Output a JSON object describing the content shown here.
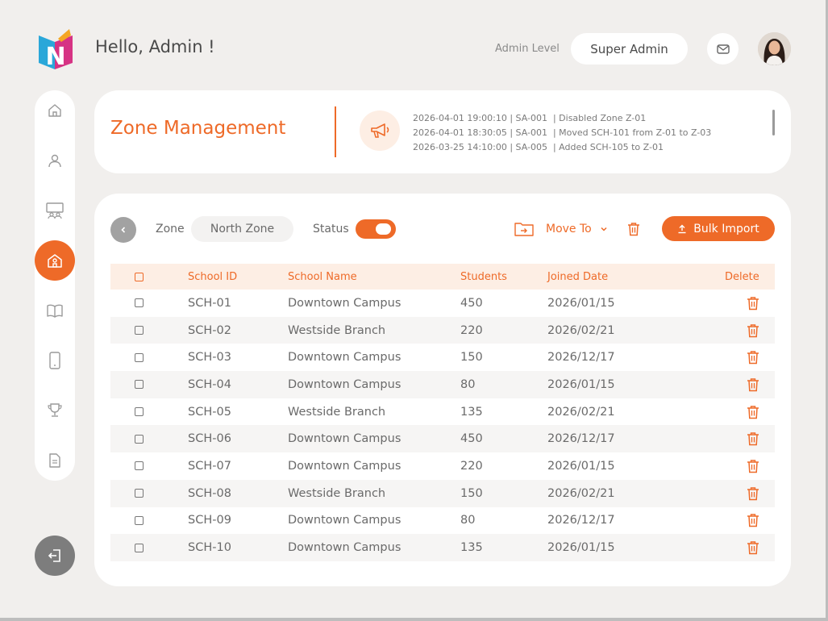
{
  "header": {
    "greeting": "Hello, Admin !",
    "admin_level_label": "Admin Level",
    "role": "Super Admin",
    "mail_icon": "mail-icon",
    "logo_letter": "N"
  },
  "sidebar": {
    "items": [
      {
        "icon": "home-icon"
      },
      {
        "icon": "user-icon"
      },
      {
        "icon": "classroom-icon"
      },
      {
        "icon": "school-icon",
        "active": true
      },
      {
        "icon": "book-icon"
      },
      {
        "icon": "tablet-icon"
      },
      {
        "icon": "trophy-icon"
      },
      {
        "icon": "document-icon"
      }
    ],
    "logout_icon": "logout-icon"
  },
  "title_card": {
    "title": "Zone Management",
    "announce_icon": "megaphone-icon",
    "logs": [
      {
        "ts": "2026-04-01 19:00:10",
        "user": "SA-001",
        "msg": "Disabled Zone Z-01"
      },
      {
        "ts": "2026-04-01 18:30:05",
        "user": "SA-001",
        "msg": "Moved SCH-101 from Z-01 to Z-03"
      },
      {
        "ts": "2026-03-25 14:10:00",
        "user": "SA-005",
        "msg": "Added SCH-105 to Z-01"
      }
    ]
  },
  "toolbar": {
    "zone_label": "Zone",
    "zone_value": "North Zone",
    "status_label": "Status",
    "status_on": true,
    "move_to_label": "Move To",
    "bulk_import_label": "Bulk Import"
  },
  "table": {
    "columns": {
      "school_id": "School ID",
      "school_name": "School Name",
      "students": "Students",
      "joined_date": "Joined Date",
      "delete": "Delete"
    },
    "rows": [
      {
        "id": "SCH-01",
        "name": "Downtown Campus",
        "students": "450",
        "date": "2026/01/15"
      },
      {
        "id": "SCH-02",
        "name": "Westside Branch",
        "students": "220",
        "date": "2026/02/21"
      },
      {
        "id": "SCH-03",
        "name": "Downtown Campus",
        "students": "150",
        "date": "2026/12/17"
      },
      {
        "id": "SCH-04",
        "name": "Downtown Campus",
        "students": "80",
        "date": "2026/01/15"
      },
      {
        "id": "SCH-05",
        "name": "Westside Branch",
        "students": "135",
        "date": "2026/02/21"
      },
      {
        "id": "SCH-06",
        "name": "Downtown Campus",
        "students": "450",
        "date": "2026/12/17"
      },
      {
        "id": "SCH-07",
        "name": "Downtown Campus",
        "students": "220",
        "date": "2026/01/15"
      },
      {
        "id": "SCH-08",
        "name": "Westside Branch",
        "students": "150",
        "date": "2026/02/21"
      },
      {
        "id": "SCH-09",
        "name": "Downtown Campus",
        "students": "80",
        "date": "2026/12/17"
      },
      {
        "id": "SCH-10",
        "name": "Downtown Campus",
        "students": "135",
        "date": "2026/01/15"
      }
    ]
  },
  "colors": {
    "accent": "#ee6a28",
    "accent_soft": "#fdeee4",
    "background": "#f1efed"
  }
}
